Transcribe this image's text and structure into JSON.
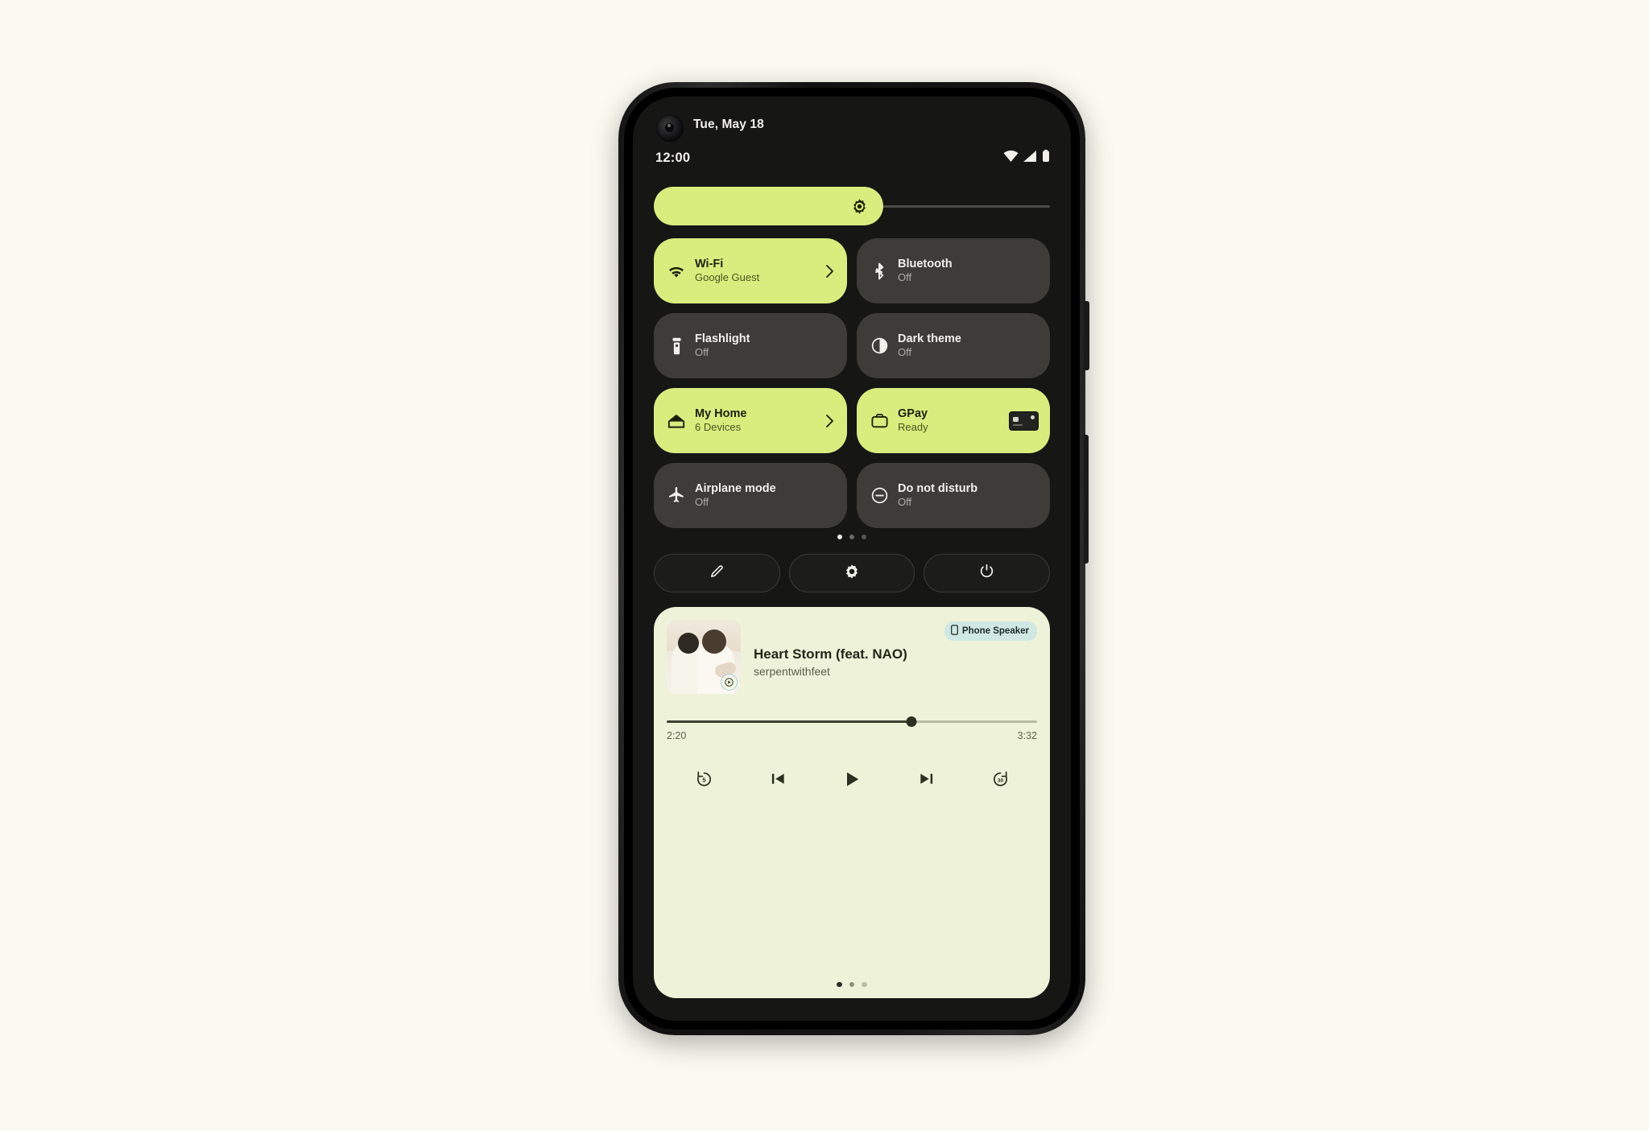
{
  "background_color": "#fbfaf1",
  "device": {
    "name": "Pixel phone",
    "frame_color": "#151515",
    "screen_background": "#161615",
    "side_buttons": [
      "power-button",
      "volume-rocker"
    ]
  },
  "theme": {
    "accent_lime": "#d8ed7e",
    "tile_inactive": "#3d3c38",
    "text_light": "#f1f0ea",
    "text_dark": "#1b2108",
    "media_background": "#eef2d9",
    "chip_background": "#cfe8e3"
  },
  "status_bar": {
    "date": "Tue, May 18",
    "time": "12:00",
    "icons": [
      "wifi-icon",
      "cellular-signal-icon",
      "battery-icon"
    ]
  },
  "brightness": {
    "label": "Brightness",
    "icon": "brightness-icon",
    "fill_percent": 58
  },
  "quick_settings": {
    "tiles": [
      {
        "title": "Wi-Fi",
        "subtitle": "Google Guest",
        "icon": "wifi-icon",
        "state": "on",
        "trailing": "chevron-right-icon"
      },
      {
        "title": "Bluetooth",
        "subtitle": "Off",
        "icon": "bluetooth-icon",
        "state": "off",
        "trailing": ""
      },
      {
        "title": "Flashlight",
        "subtitle": "Off",
        "icon": "flashlight-icon",
        "state": "off",
        "trailing": ""
      },
      {
        "title": "Dark theme",
        "subtitle": "Off",
        "icon": "dark-theme-icon",
        "state": "off",
        "trailing": ""
      },
      {
        "title": "My Home",
        "subtitle": "6 Devices",
        "icon": "home-icon",
        "state": "on",
        "trailing": "chevron-right-icon"
      },
      {
        "title": "GPay",
        "subtitle": "Ready",
        "icon": "wallet-icon",
        "state": "on",
        "trailing": "payment-card-thumbnail"
      },
      {
        "title": "Airplane mode",
        "subtitle": "Off",
        "icon": "airplane-icon",
        "state": "off",
        "trailing": ""
      },
      {
        "title": "Do not disturb",
        "subtitle": "Off",
        "icon": "do-not-disturb-icon",
        "state": "off",
        "trailing": ""
      }
    ],
    "page_dots": {
      "count": 3,
      "active_index": 0
    }
  },
  "footer_buttons": [
    {
      "name": "edit-tiles-button",
      "icon": "pencil-icon"
    },
    {
      "name": "settings-button",
      "icon": "gear-icon"
    },
    {
      "name": "power-button",
      "icon": "power-icon"
    }
  ],
  "media_player": {
    "output_chip": {
      "label": "Phone Speaker",
      "icon": "phone-icon"
    },
    "title": "Heart Storm (feat. NAO)",
    "artist": "serpentwithfeet",
    "album_art": "two-people-embracing-photo",
    "app_badge": "youtube-music-play-icon",
    "elapsed": "2:20",
    "duration": "3:32",
    "progress_percent": 66,
    "controls": [
      {
        "name": "replay-5-button",
        "icon": "replay-5-icon"
      },
      {
        "name": "previous-track-button",
        "icon": "skip-previous-icon"
      },
      {
        "name": "play-button",
        "icon": "play-icon"
      },
      {
        "name": "next-track-button",
        "icon": "skip-next-icon"
      },
      {
        "name": "forward-30-button",
        "icon": "forward-30-icon"
      }
    ],
    "page_dots": {
      "count": 3,
      "active_index": 0
    }
  }
}
